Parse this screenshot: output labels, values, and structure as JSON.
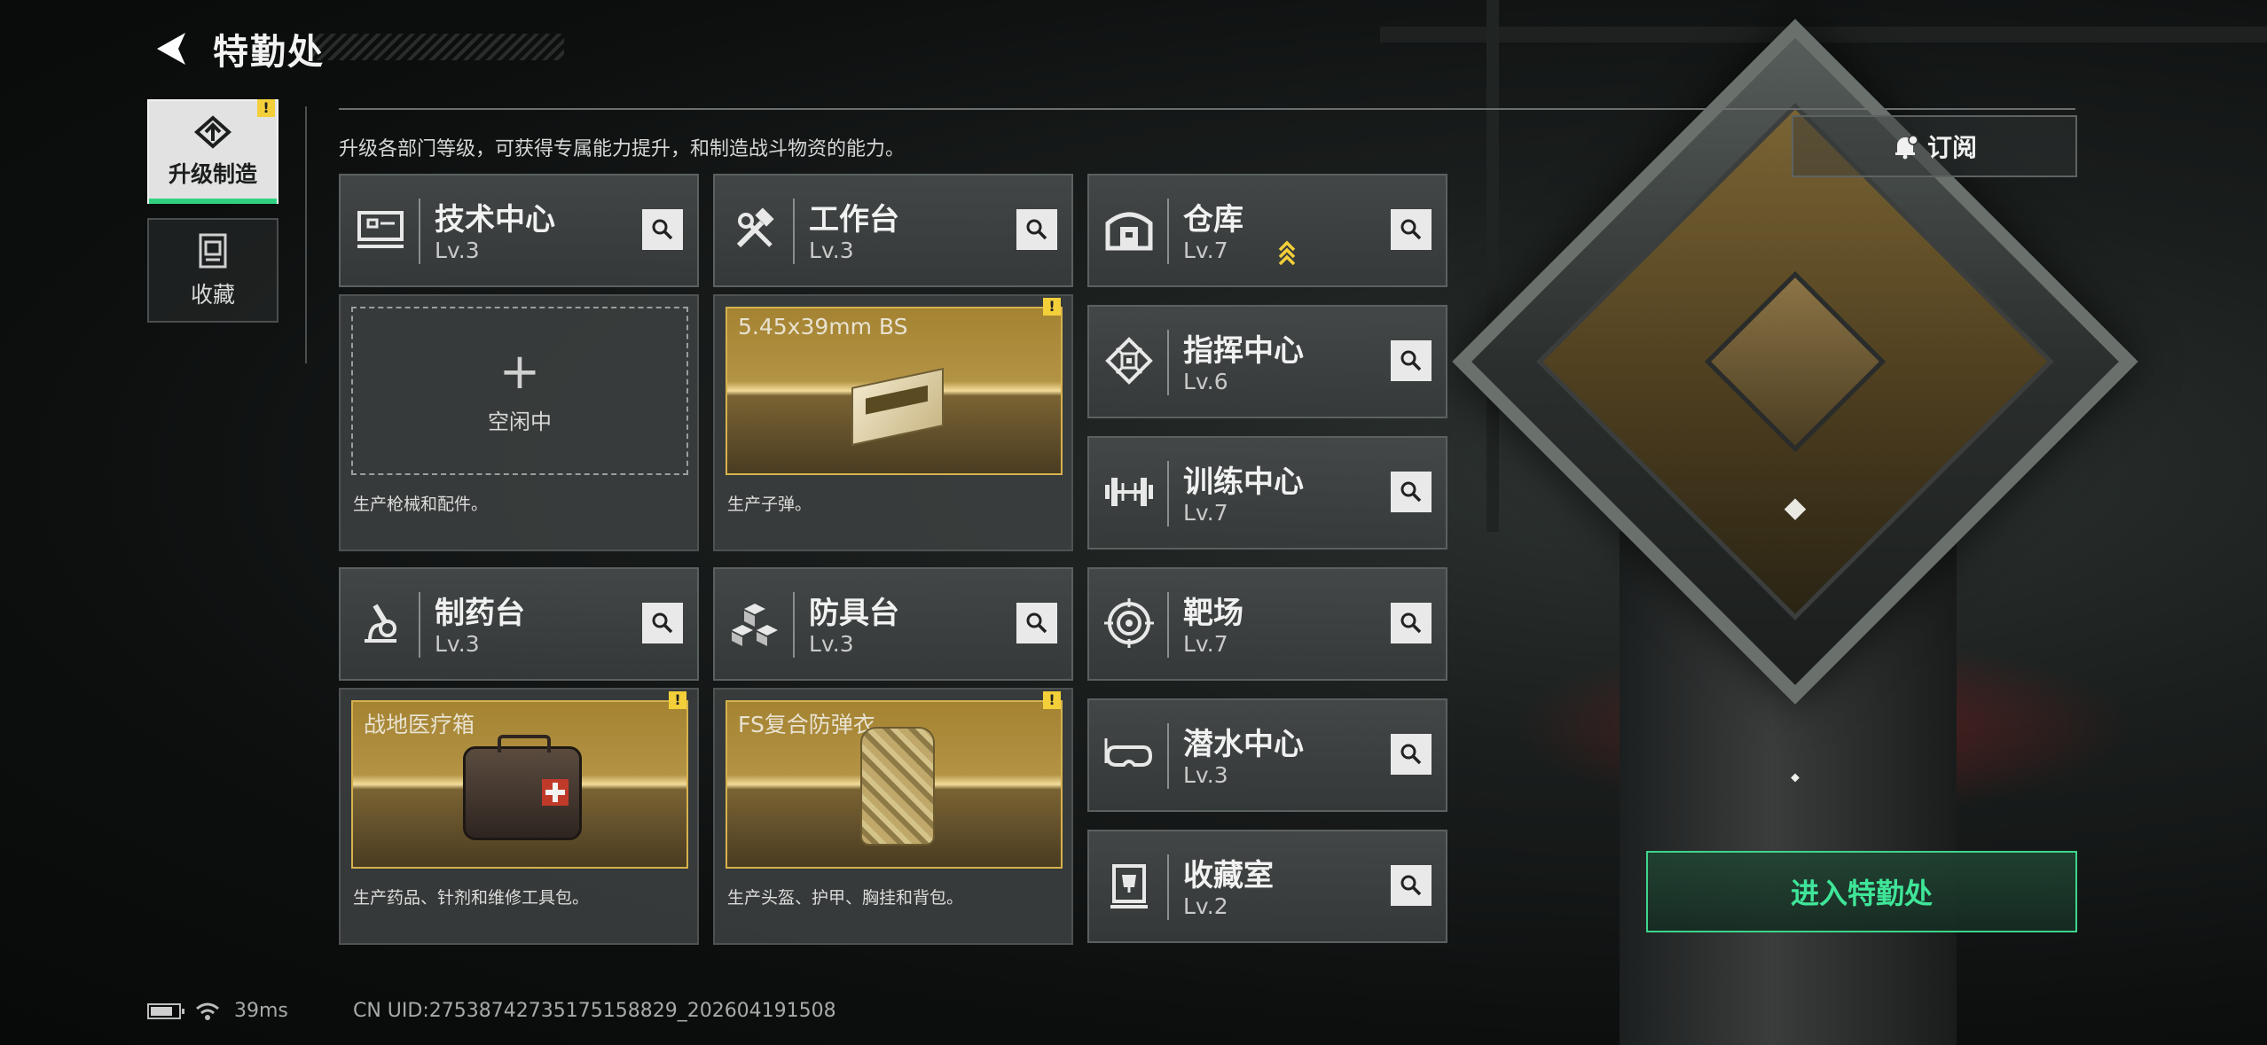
{
  "header": {
    "title": "特勤处"
  },
  "sidebar": {
    "items": [
      {
        "label": "升级制造",
        "active": true,
        "alert": "!"
      },
      {
        "label": "收藏",
        "active": false
      }
    ]
  },
  "description": "升级各部门等级，可获得专属能力提升，和制造战斗物资的能力。",
  "subscribe_label": "订阅",
  "stations": [
    {
      "name": "技术中心",
      "level": "Lv.3",
      "icon": "monitor-icon",
      "production": {
        "state": "idle",
        "idle_label": "空闲中",
        "desc": "生产枪械和配件。"
      }
    },
    {
      "name": "工作台",
      "level": "Lv.3",
      "icon": "tools-icon",
      "production": {
        "state": "producing",
        "item": "5.45x39mm BS",
        "alert": "!",
        "desc": "生产子弹。"
      }
    },
    {
      "name": "制药台",
      "level": "Lv.3",
      "icon": "microscope-icon",
      "production": {
        "state": "producing",
        "item": "战地医疗箱",
        "alert": "!",
        "desc": "生产药品、针剂和维修工具包。"
      }
    },
    {
      "name": "防具台",
      "level": "Lv.3",
      "icon": "armor-blocks-icon",
      "production": {
        "state": "producing",
        "item": "FS复合防弹衣",
        "alert": "!",
        "desc": "生产头盔、护甲、胸挂和背包。"
      }
    },
    {
      "name": "仓库",
      "level": "Lv.7",
      "icon": "warehouse-icon",
      "upgrade_available": true
    },
    {
      "name": "指挥中心",
      "level": "Lv.6",
      "icon": "chip-icon"
    },
    {
      "name": "训练中心",
      "level": "Lv.7",
      "icon": "dumbbell-icon"
    },
    {
      "name": "靶场",
      "level": "Lv.7",
      "icon": "target-icon"
    },
    {
      "name": "潜水中心",
      "level": "Lv.3",
      "icon": "diving-mask-icon"
    },
    {
      "name": "收藏室",
      "level": "Lv.2",
      "icon": "trophy-icon"
    }
  ],
  "enter_button": "进入特勤处",
  "status": {
    "ping": "39ms",
    "uid": "CN UID:27538742735175158829_202604191508"
  },
  "colors": {
    "accent": "#3fe598",
    "gold": "#d6b24d",
    "alert": "#f3cf3a"
  }
}
